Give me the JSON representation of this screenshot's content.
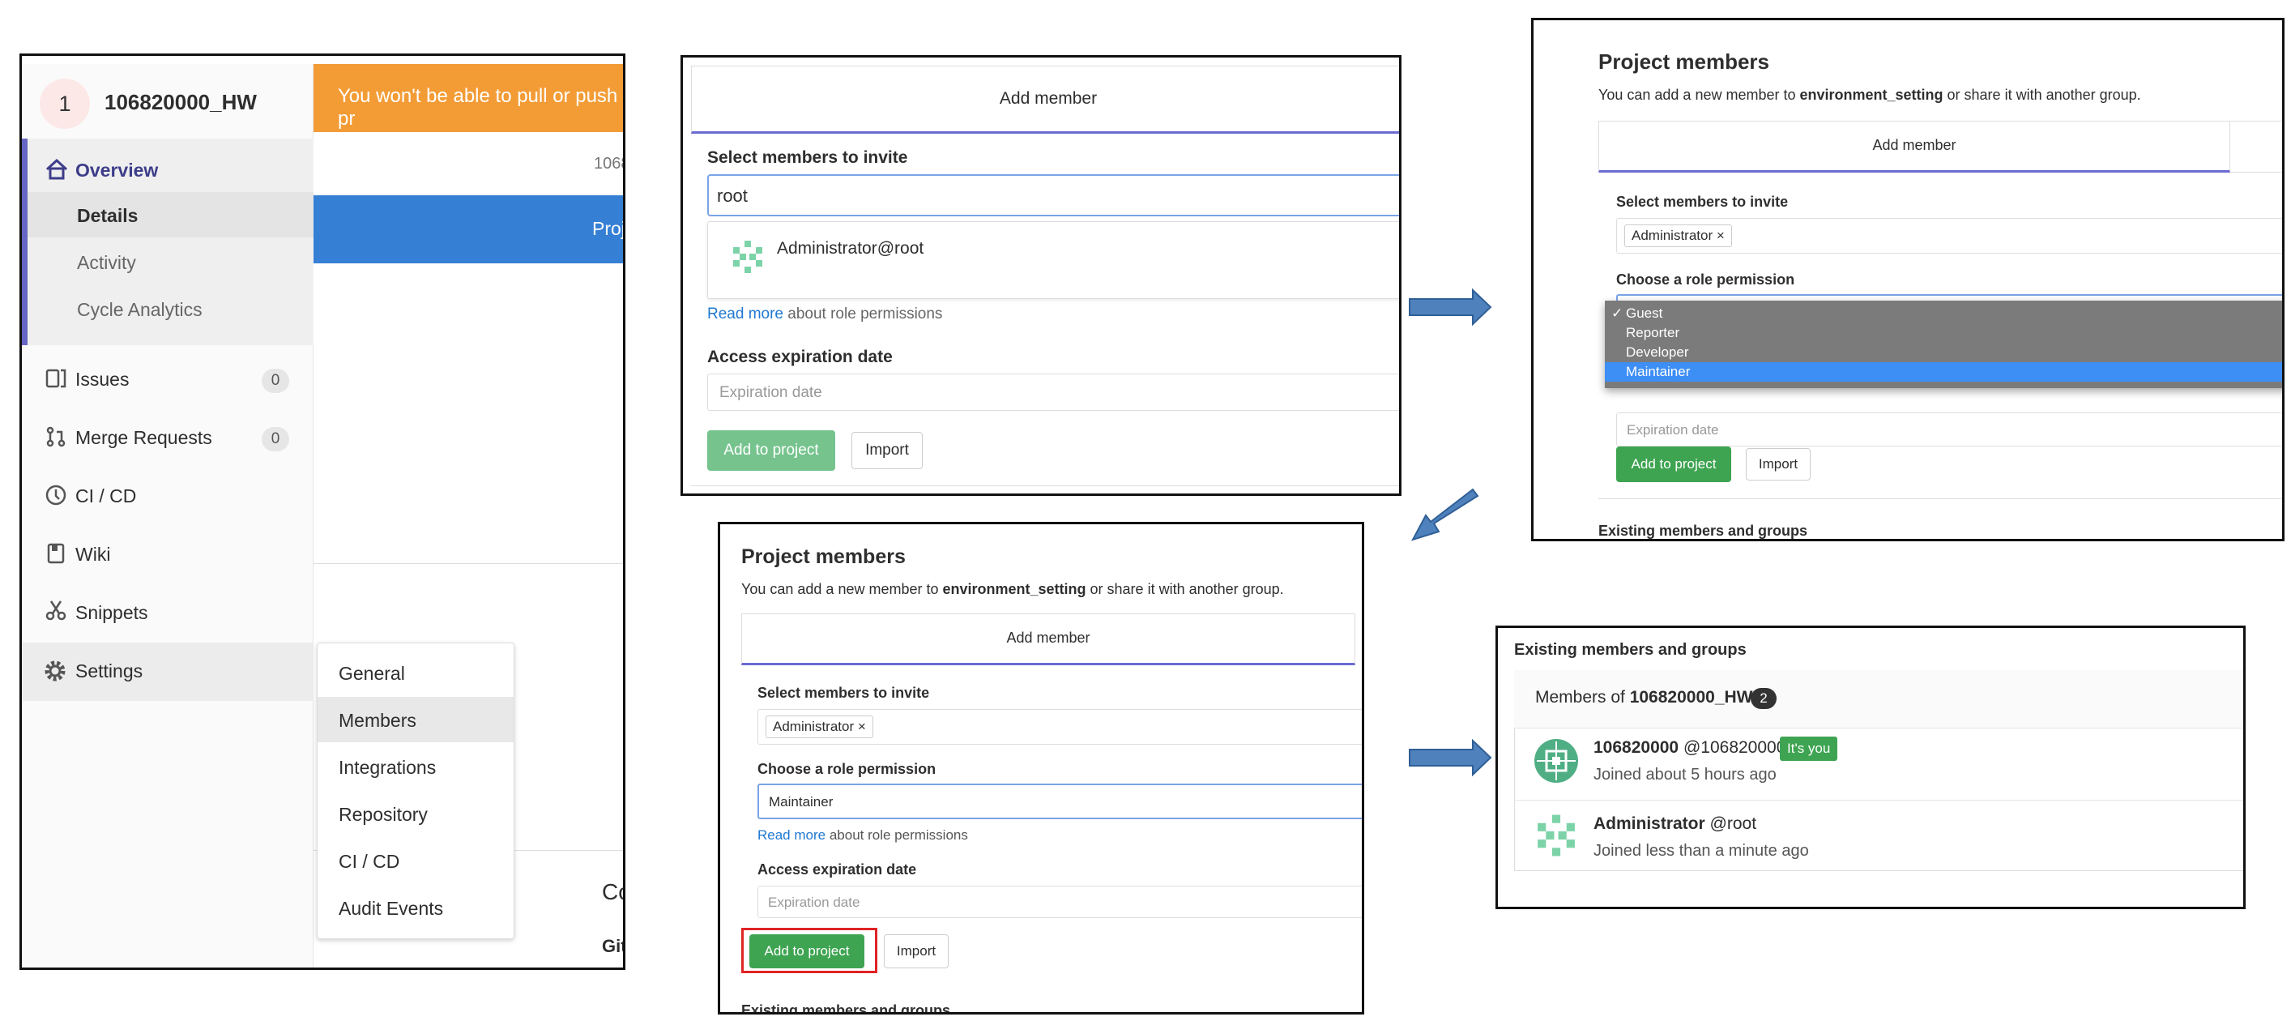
{
  "sidebar": {
    "project_initial": "1",
    "project_name": "106820000_HW",
    "items": [
      {
        "label": "Overview",
        "icon": "home-icon"
      },
      {
        "label": "Details"
      },
      {
        "label": "Activity"
      },
      {
        "label": "Cycle Analytics"
      },
      {
        "label": "Issues",
        "icon": "issues-icon",
        "count": "0"
      },
      {
        "label": "Merge Requests",
        "icon": "merge-request-icon",
        "count": "0"
      },
      {
        "label": "CI / CD",
        "icon": "ci-cd-icon"
      },
      {
        "label": "Wiki",
        "icon": "book-icon"
      },
      {
        "label": "Snippets",
        "icon": "scissors-icon"
      },
      {
        "label": "Settings",
        "icon": "gear-icon"
      }
    ],
    "settings_flyout": [
      "General",
      "Members",
      "Integrations",
      "Repository",
      "CI / CD",
      "Audit Events"
    ],
    "alert_text": "You won't be able to pull or push pr",
    "number_fragment": "1068",
    "blue_fragment": "Proj",
    "content_fragment_1": "Co",
    "content_fragment_2": "Git"
  },
  "panel_add": {
    "tab_label": "Add member",
    "select_label": "Select members to invite",
    "search_value": "root",
    "suggestion": "Administrator@root",
    "read_more_link": "Read more",
    "read_more_text": "about role permissions",
    "expiration_label": "Access expiration date",
    "expiration_placeholder": "Expiration date",
    "add_button": "Add to project",
    "import_button": "Import"
  },
  "panel_role": {
    "title": "Project members",
    "subtitle_pre": "You can add a new member to ",
    "project": "environment_setting",
    "subtitle_post": " or share it with another group.",
    "tab_label": "Add member",
    "select_label": "Select members to invite",
    "token": "Administrator ×",
    "role_label": "Choose a role permission",
    "options": [
      "Guest",
      "Reporter",
      "Developer",
      "Maintainer"
    ],
    "checked_option": "Guest",
    "check_mark": "✓",
    "expiration_placeholder": "Expiration date",
    "add_button": "Add to project",
    "import_button": "Import",
    "existing_heading": "Existing members and groups"
  },
  "panel_maint": {
    "title": "Project members",
    "subtitle_pre": "You can add a new member to ",
    "project": "environment_setting",
    "subtitle_post": " or share it with another group.",
    "tab_label": "Add member",
    "select_label": "Select members to invite",
    "token": "Administrator ×",
    "role_label": "Choose a role permission",
    "role_value": "Maintainer",
    "read_more_link": "Read more",
    "read_more_text": "about role permissions",
    "expiration_label": "Access expiration date",
    "expiration_placeholder": "Expiration date",
    "add_button": "Add to project",
    "import_button": "Import",
    "existing_heading": "Existing members and groups"
  },
  "panel_existing": {
    "heading": "Existing members and groups",
    "members_of": "Members of ",
    "group": "106820000_HW",
    "count": "2",
    "members": [
      {
        "name": "106820000",
        "handle": "@106820000",
        "badge": "It's you",
        "joined": "Joined about 5 hours ago"
      },
      {
        "name": "Administrator",
        "handle": "@root",
        "joined": "Joined less than a minute ago"
      }
    ]
  },
  "colors": {
    "accent": "#6666c4",
    "alert": "#f39c36",
    "blue_bar": "#3580d5",
    "green_button": "#3ea451",
    "highlight": "#e02424",
    "arrow": "#4f81bd"
  }
}
